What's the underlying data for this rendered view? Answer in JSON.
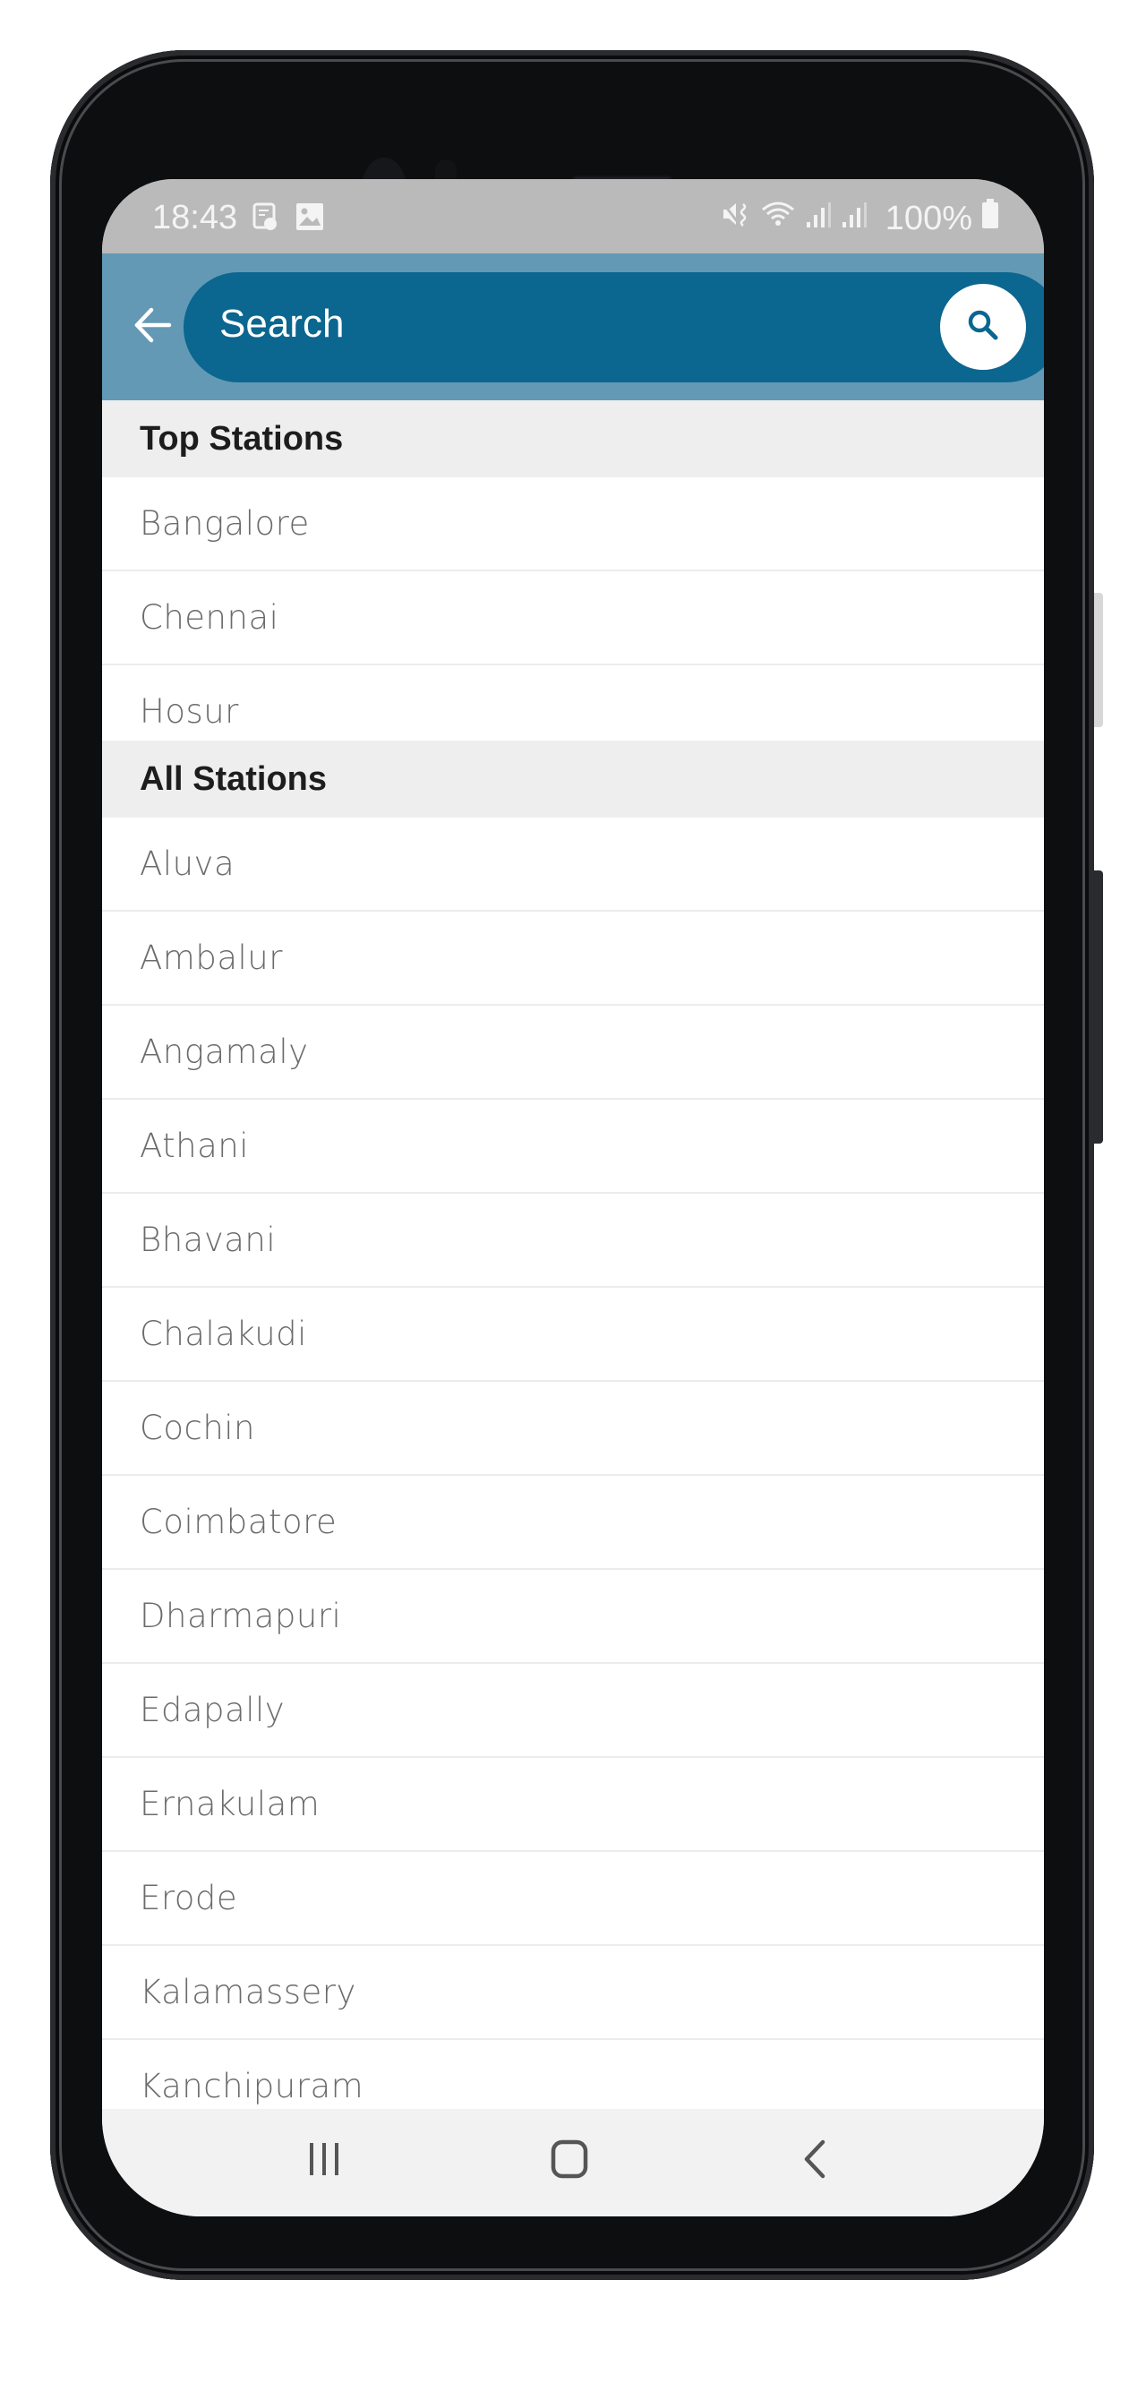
{
  "status_bar": {
    "time": "18:43",
    "left_icons": [
      "task-check-icon",
      "image-icon"
    ],
    "right_icons": [
      "mute-vibrate-icon",
      "wifi-icon",
      "signal-icon",
      "signal-icon"
    ],
    "battery": "100%"
  },
  "app_bar": {
    "back_icon": "arrow-left-icon",
    "search_placeholder": "Search",
    "search_value": "",
    "search_button_icon": "search-icon"
  },
  "colors": {
    "app_bar": "#6399b5",
    "search_pill": "#0b6690",
    "section_header_bg": "#eeeeee",
    "item_text": "#6b6b6b"
  },
  "sections": {
    "top": {
      "title": "Top Stations",
      "items": [
        "Bangalore",
        "Chennai",
        "Hosur"
      ]
    },
    "all": {
      "title": "All Stations",
      "items": [
        "Aluva",
        "Ambalur",
        "Angamaly",
        "Athani",
        "Bhavani",
        "Chalakudi",
        "Cochin",
        "Coimbatore",
        "Dharmapuri",
        "Edapally",
        "Ernakulam",
        "Erode",
        "Kalamassery",
        "Kanchipuram"
      ]
    }
  },
  "nav_bar": {
    "buttons": [
      "recent-apps-icon",
      "home-icon",
      "back-icon"
    ]
  }
}
